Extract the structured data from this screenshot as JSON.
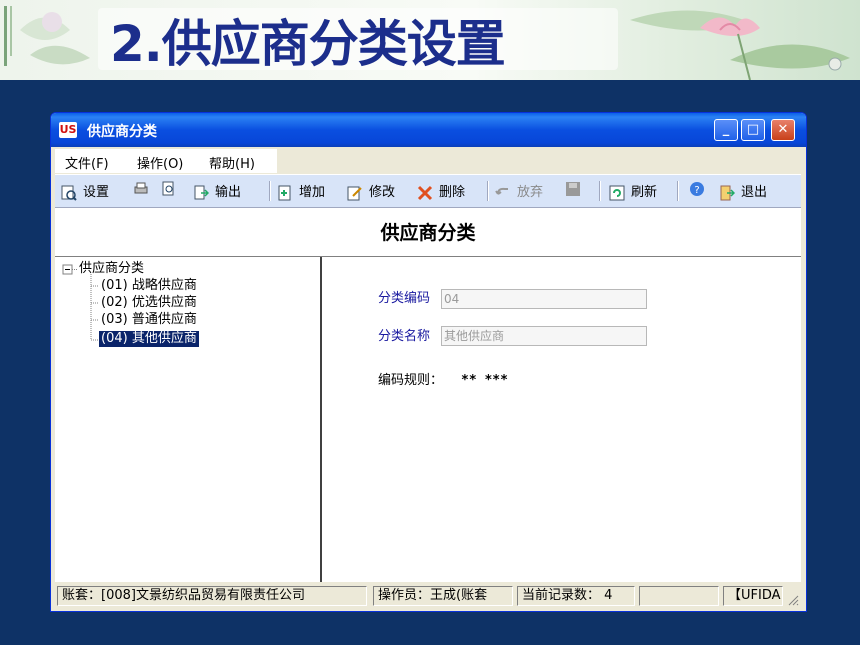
{
  "slide": {
    "title": "2.供应商分类设置"
  },
  "window": {
    "title": "供应商分类",
    "logo_text": "US",
    "controls": {
      "minimize": "_",
      "maximize": "□",
      "close": "✕"
    }
  },
  "menu": [
    {
      "label": "文件(F)"
    },
    {
      "label": "操作(O)"
    },
    {
      "label": "帮助(H)"
    }
  ],
  "toolbar": {
    "setup": "设置",
    "print": "",
    "preview": "",
    "output": "输出",
    "add": "增加",
    "edit": "修改",
    "delete": "删除",
    "discard": "放弃",
    "save": "",
    "refresh": "刷新",
    "help": "",
    "exit": "退出"
  },
  "form": {
    "heading": "供应商分类"
  },
  "tree": {
    "root": "供应商分类",
    "expander": "−",
    "items": [
      {
        "label": "(01) 战略供应商"
      },
      {
        "label": "(02) 优选供应商"
      },
      {
        "label": "(03) 普通供应商"
      },
      {
        "label": "(04) 其他供应商",
        "selected": true
      }
    ]
  },
  "detail": {
    "code_label": "分类编码",
    "code_value": "04",
    "name_label": "分类名称",
    "name_value": "其他供应商",
    "rule_label": "编码规则：",
    "rule_value": "** ***"
  },
  "status": {
    "account": "账套：[008]文景纺织品贸易有限责任公司",
    "operator": "操作员：王成(账套",
    "record_count": "当前记录数： 4",
    "empty": "",
    "brand": "【UFIDA"
  },
  "colors": {
    "background": "#0e3266",
    "title_text": "#1c2e8c",
    "titlebar": "#0846d8",
    "selection": "#0a246a",
    "label_blue": "#1a1aa0"
  }
}
